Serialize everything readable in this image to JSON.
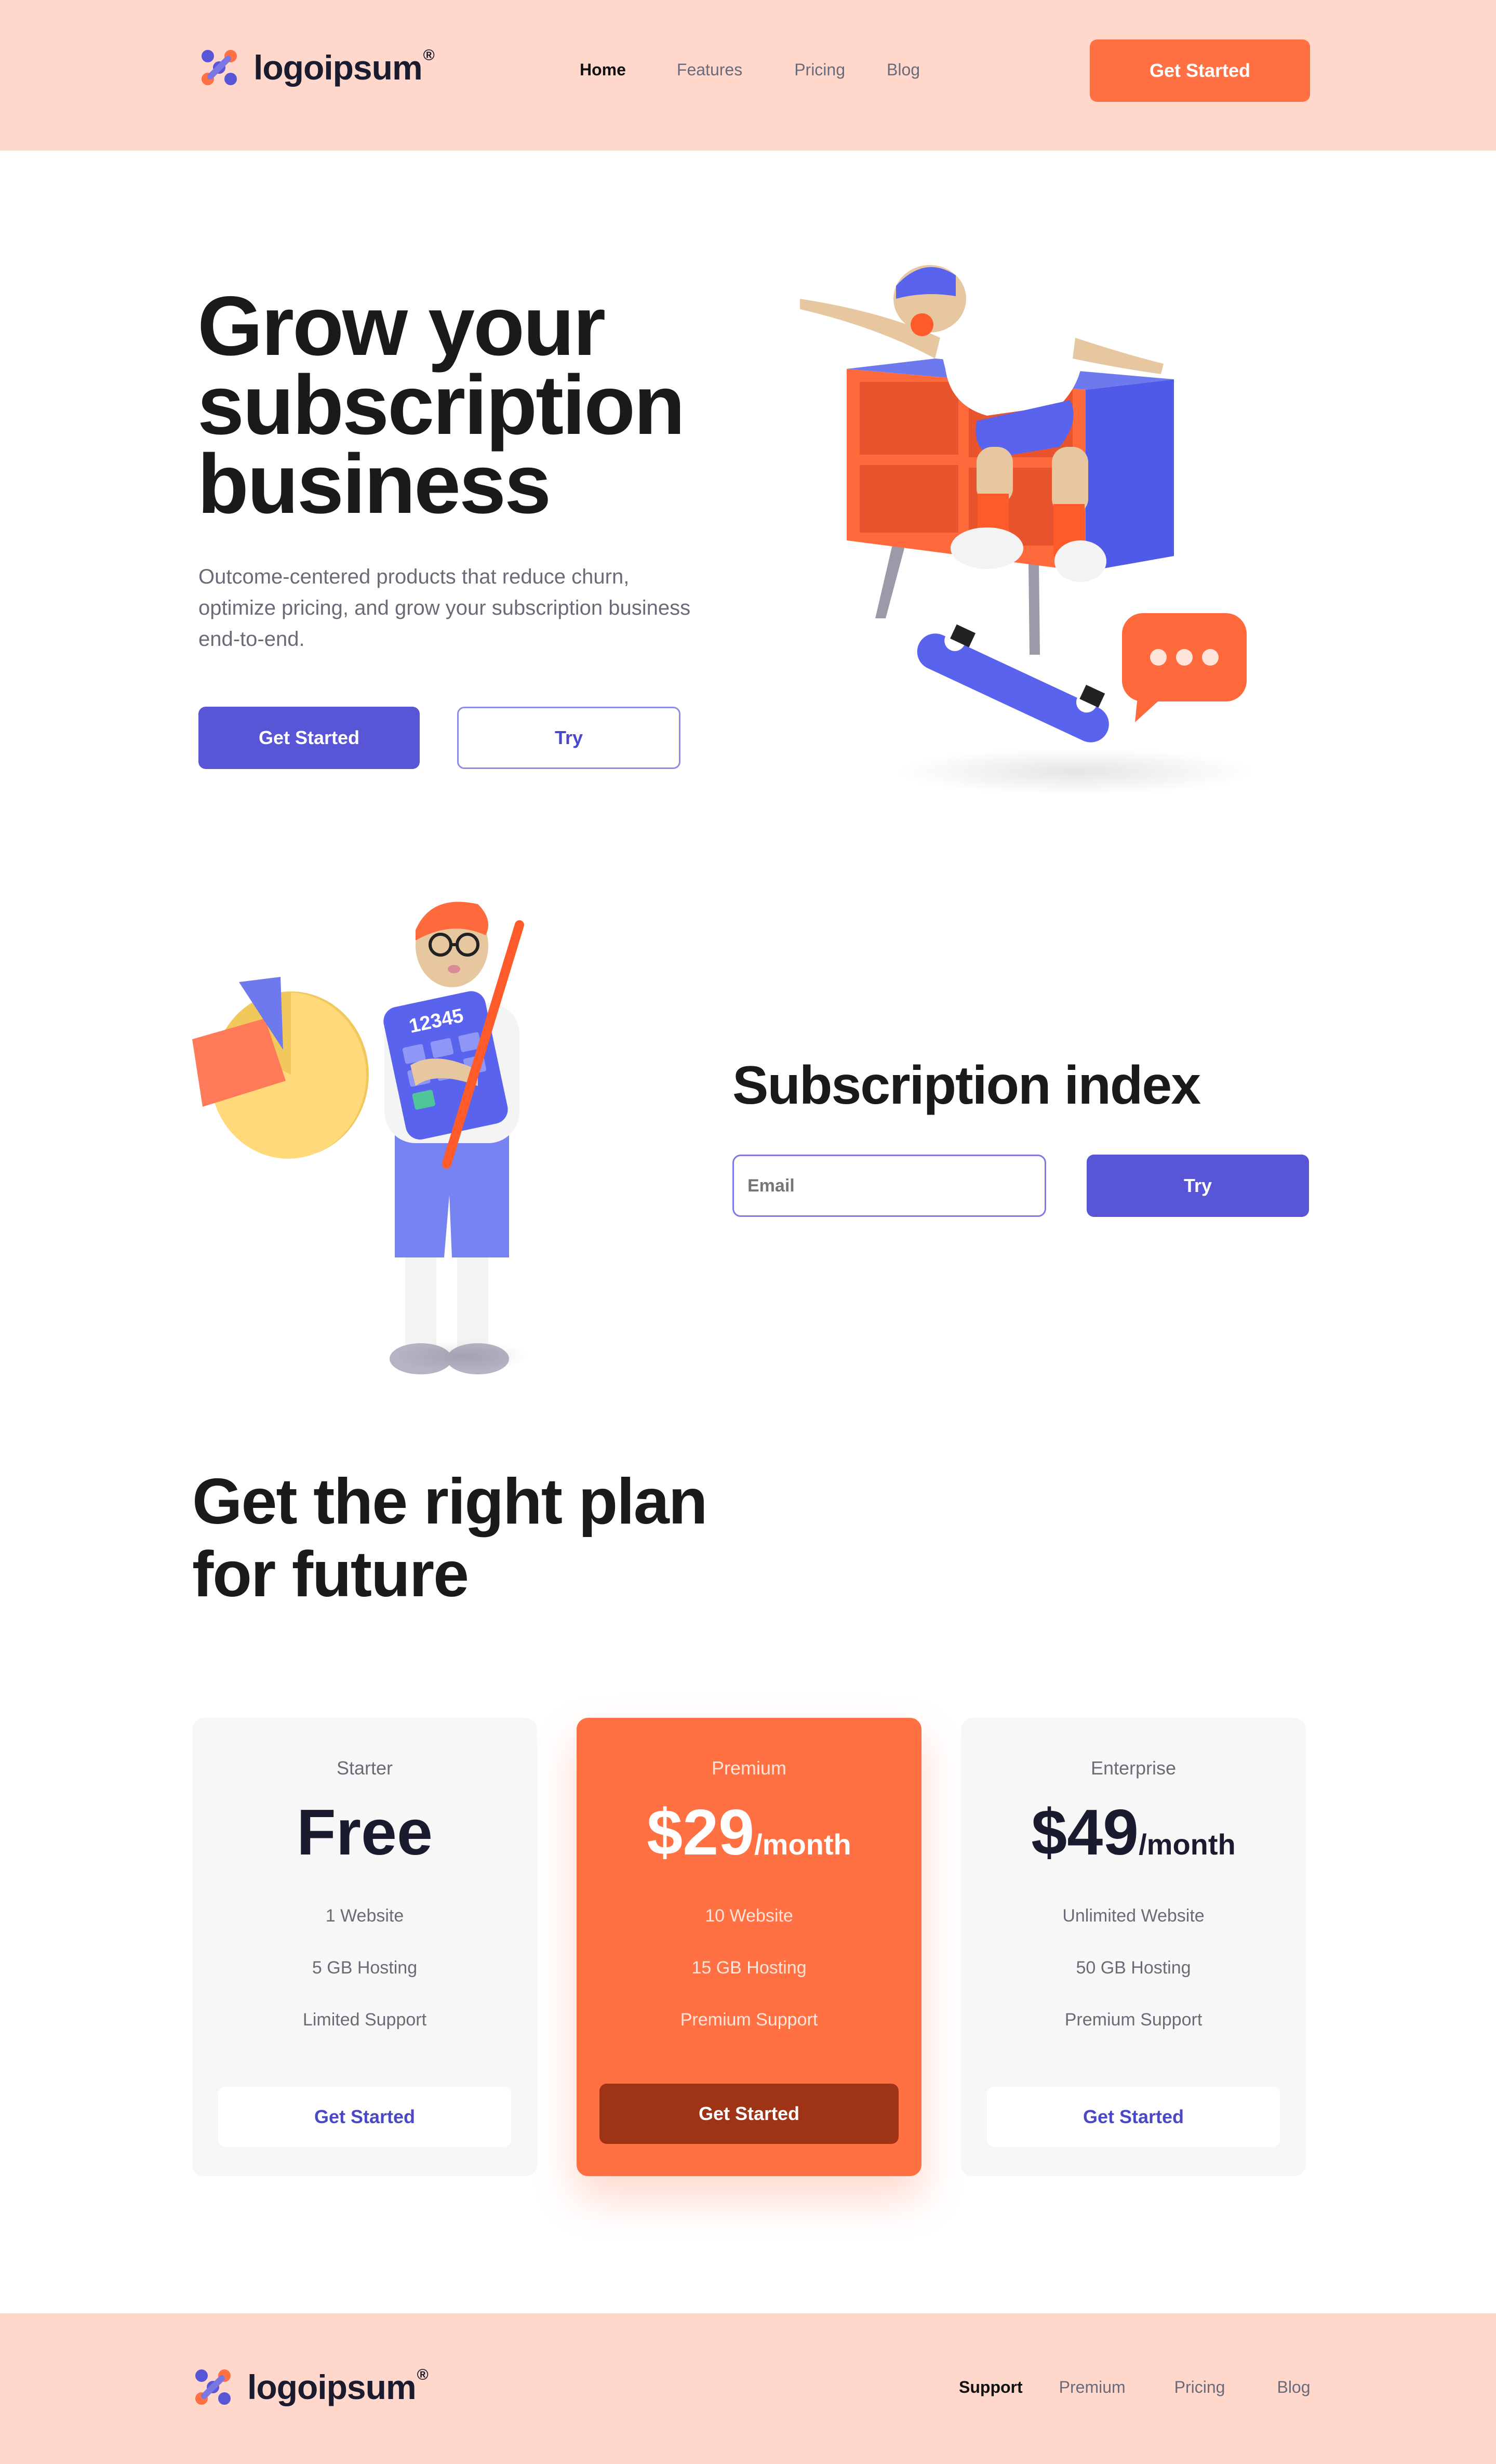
{
  "brand": {
    "name": "logoipsum",
    "mark": "®"
  },
  "colors": {
    "accent": "#ff7043",
    "primary": "#5855d6",
    "header_bg": "#ffd8cb",
    "dark": "#1b1b2f"
  },
  "nav": {
    "items": [
      {
        "label": "Home",
        "active": true
      },
      {
        "label": "Features",
        "active": false
      },
      {
        "label": "Pricing",
        "active": false
      },
      {
        "label": "Blog",
        "active": false
      }
    ],
    "cta_label": "Get Started"
  },
  "hero": {
    "title_lines": [
      "Grow your",
      "subscription",
      "business"
    ],
    "subtitle_lines": [
      "Outcome-centered products that reduce churn,",
      "optimize pricing, and grow your subscription business",
      "end-to-end."
    ],
    "primary_label": "Get Started",
    "secondary_label": "Try"
  },
  "index": {
    "title": "Subscription index",
    "email_placeholder": "Email",
    "submit_label": "Try",
    "calculator_text": "12345"
  },
  "pricing": {
    "title_lines": [
      "Get the right plan",
      "for future"
    ],
    "plans": [
      {
        "name": "Starter",
        "price": "Free",
        "per": "",
        "features": [
          "1 Website",
          "5 GB Hosting",
          "Limited Support"
        ],
        "cta": "Get Started"
      },
      {
        "name": "Premium",
        "price": "$29",
        "per": "/month",
        "features": [
          "10 Website",
          "15 GB Hosting",
          "Premium Support"
        ],
        "cta": "Get Started"
      },
      {
        "name": "Enterprise",
        "price": "$49",
        "per": "/month",
        "features": [
          "Unlimited Website",
          "50 GB Hosting",
          "Premium Support"
        ],
        "cta": "Get Started"
      }
    ]
  },
  "footer": {
    "links": [
      {
        "label": "Support",
        "active": true
      },
      {
        "label": "Premium",
        "active": false
      },
      {
        "label": "Pricing",
        "active": false
      },
      {
        "label": "Blog",
        "active": false
      }
    ]
  }
}
